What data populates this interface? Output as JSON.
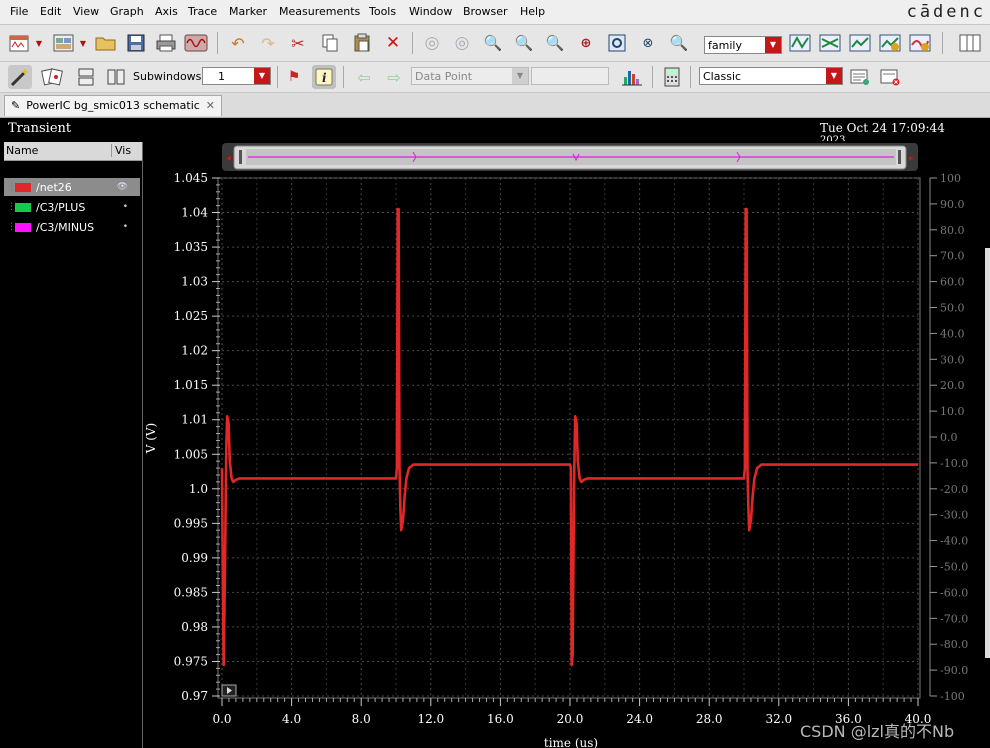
{
  "menubar": {
    "items": [
      "File",
      "Edit",
      "View",
      "Graph",
      "Axis",
      "Trace",
      "Marker",
      "Measurements",
      "Tools",
      "Window",
      "Browser",
      "Help"
    ],
    "brand": "cādenc"
  },
  "toolbar": {
    "font_select": "family",
    "subwindows_label": "Subwindows:",
    "subwindows_value": "1",
    "data_point_select": "Data Point",
    "style_select": "Classic"
  },
  "tabs": {
    "document": "PowerIC bg_smic013 schematic"
  },
  "plot": {
    "title": "Transient",
    "timestamp": "Tue Oct 24 17:09:44",
    "year_fragment": "2023"
  },
  "legend": {
    "header_name": "Name",
    "header_vis": "Vis",
    "items": [
      {
        "name": "/net26",
        "color": "#e02828"
      },
      {
        "name": "/C3/PLUS",
        "color": "#14c850"
      },
      {
        "name": "/C3/MINUS",
        "color": "#ff10ff"
      }
    ]
  },
  "watermark": "CSDN @lzl真的不Nb",
  "chart_data": {
    "type": "line",
    "xlabel": "time (us)",
    "ylabel": "V (V)",
    "xlim": [
      0,
      40
    ],
    "ylim": [
      0.97,
      1.045
    ],
    "y2lim": [
      -100,
      100
    ],
    "x_ticks": [
      "0.0",
      "4.0",
      "8.0",
      "12.0",
      "16.0",
      "20.0",
      "24.0",
      "28.0",
      "32.0",
      "36.0",
      "40.0"
    ],
    "y_ticks": [
      "0.97",
      "0.975",
      "0.98",
      "0.985",
      "0.99",
      "0.995",
      "1.0",
      "1.005",
      "1.01",
      "1.015",
      "1.02",
      "1.025",
      "1.03",
      "1.035",
      "1.04",
      "1.045"
    ],
    "y2_ticks": [
      "-100",
      "-90.0",
      "-80.0",
      "-70.0",
      "-60.0",
      "-50.0",
      "-40.0",
      "-30.0",
      "-20.0",
      "-10.0",
      "0.0",
      "10.0",
      "20.0",
      "30.0",
      "40.0",
      "50.0",
      "60.0",
      "70.0",
      "80.0",
      "90.0",
      "100"
    ],
    "grid": true,
    "series": [
      {
        "name": "/net26",
        "color": "#e02828",
        "x": [
          0.0,
          0.05,
          0.1,
          0.18,
          0.25,
          0.3,
          0.38,
          0.45,
          0.55,
          0.65,
          0.8,
          1.0,
          1.3,
          10.0,
          10.05,
          10.1,
          10.15,
          10.2,
          10.25,
          10.3,
          10.4,
          10.5,
          10.6,
          10.75,
          11.0,
          11.5,
          12.0,
          20.0,
          20.05,
          20.1,
          20.15,
          20.25,
          20.3,
          20.38,
          20.45,
          20.55,
          20.65,
          20.8,
          21.0,
          21.3,
          30.0,
          30.05,
          30.1,
          30.15,
          30.2,
          30.25,
          30.3,
          30.4,
          30.5,
          30.6,
          30.75,
          31.0,
          31.5,
          32.0,
          40.0
        ],
        "values": [
          1.003,
          0.985,
          0.9745,
          0.99,
          1.006,
          1.0105,
          1.0095,
          1.004,
          1.0015,
          1.001,
          1.0013,
          1.0015,
          1.0015,
          1.0015,
          1.003,
          1.0405,
          1.0405,
          1.003,
          0.997,
          0.994,
          0.9955,
          0.999,
          1.0015,
          1.003,
          1.0035,
          1.0035,
          1.0035,
          1.0035,
          1.003,
          0.9745,
          0.976,
          1.003,
          1.0105,
          1.0095,
          1.004,
          1.0015,
          1.001,
          1.0013,
          1.0015,
          1.0015,
          1.0015,
          1.003,
          1.0405,
          1.0405,
          1.003,
          0.997,
          0.994,
          0.9955,
          0.999,
          1.0015,
          1.003,
          1.0035,
          1.0035,
          1.0035,
          1.0035
        ]
      }
    ]
  }
}
